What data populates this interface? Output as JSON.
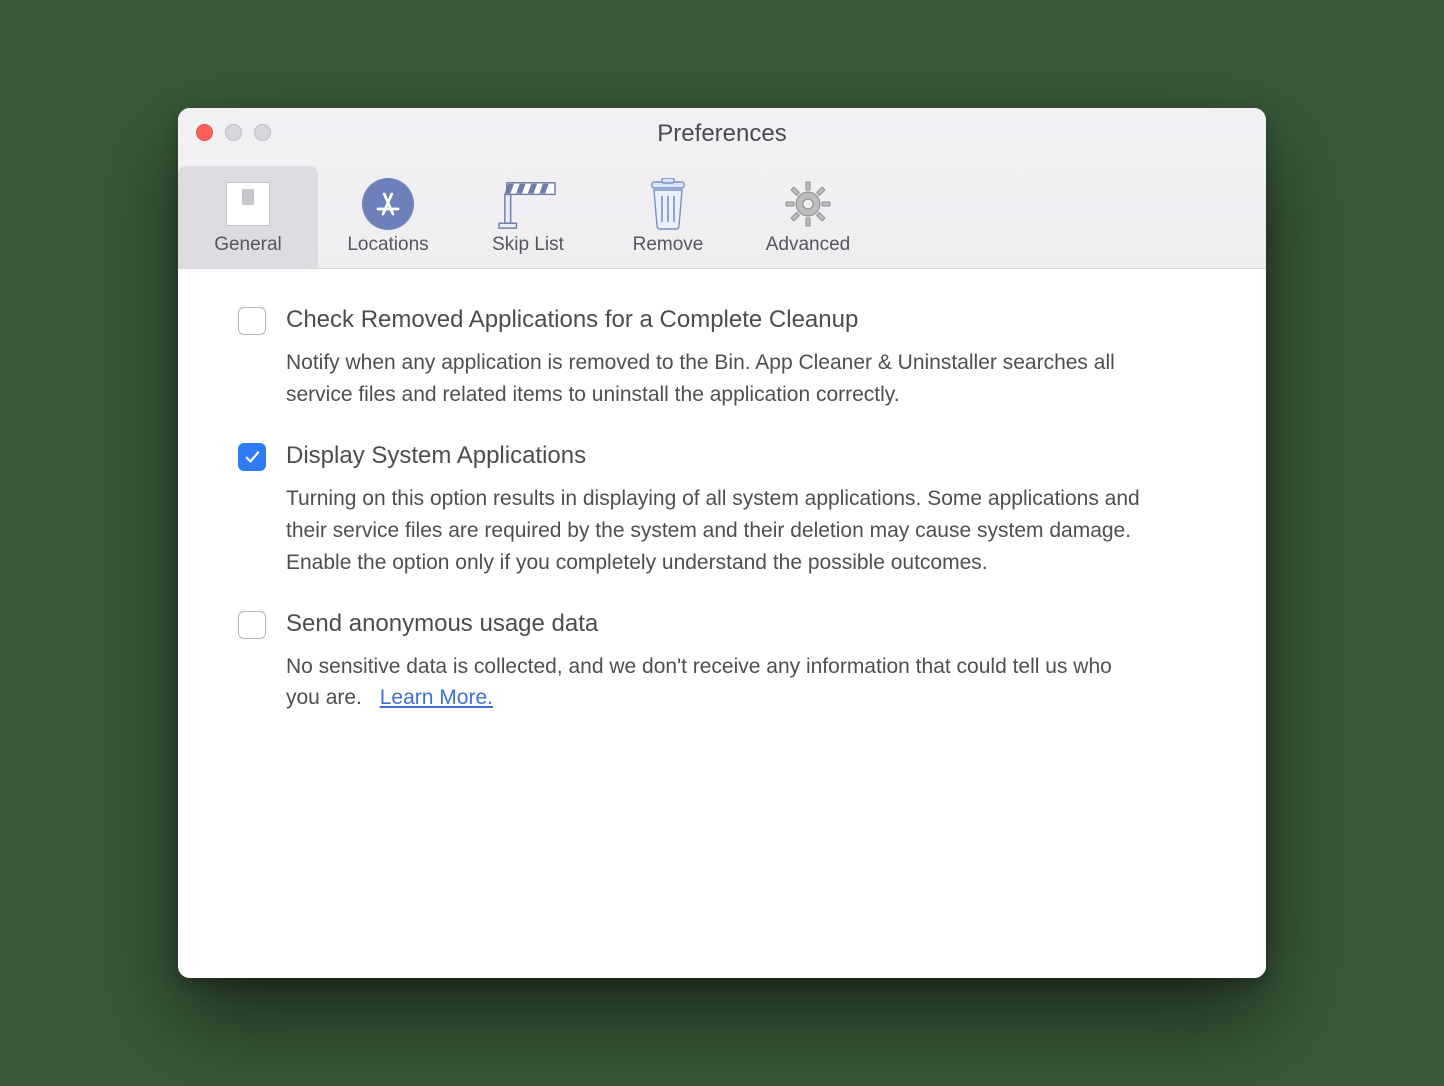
{
  "window": {
    "title": "Preferences"
  },
  "toolbar": {
    "items": [
      {
        "label": "General",
        "icon": "switch-icon",
        "active": true
      },
      {
        "label": "Locations",
        "icon": "appstore-icon",
        "active": false
      },
      {
        "label": "Skip List",
        "icon": "barrier-icon",
        "active": false
      },
      {
        "label": "Remove",
        "icon": "trash-icon",
        "active": false
      },
      {
        "label": "Advanced",
        "icon": "gear-icon",
        "active": false
      }
    ]
  },
  "options": [
    {
      "id": "check-removed",
      "checked": false,
      "title": "Check Removed Applications for a Complete Cleanup",
      "desc": "Notify when any application is removed to the Bin. App Cleaner & Uninstaller searches all service files and related items to uninstall the application correctly."
    },
    {
      "id": "display-system",
      "checked": true,
      "title": "Display System Applications",
      "desc": "Turning on this option results in displaying of all system applications. Some applications and their service files are required by the system and their deletion may cause system damage. Enable the option only if you completely understand the possible outcomes."
    },
    {
      "id": "send-usage",
      "checked": false,
      "title": "Send anonymous usage data",
      "desc": "No sensitive data is collected, and we don't receive any information that could tell us who you are.",
      "link": "Learn More."
    }
  ]
}
